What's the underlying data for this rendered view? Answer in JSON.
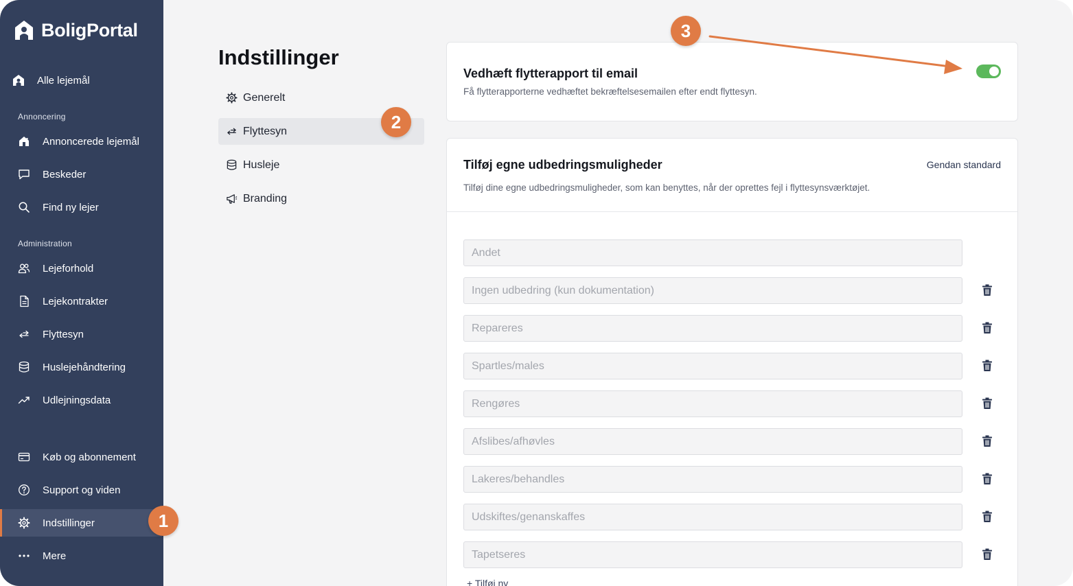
{
  "sidebar": {
    "brand": "BoligPortal",
    "top_item": {
      "label": "Alle lejemål",
      "icon": "house-icon"
    },
    "sections": [
      {
        "label": "Annoncering",
        "items": [
          {
            "label": "Annoncerede lejemål",
            "icon": "house-listing-icon"
          },
          {
            "label": "Beskeder",
            "icon": "chat-bubble-icon"
          },
          {
            "label": "Find ny lejer",
            "icon": "search-icon"
          }
        ]
      },
      {
        "label": "Administration",
        "items": [
          {
            "label": "Lejeforhold",
            "icon": "users-icon"
          },
          {
            "label": "Lejekontrakter",
            "icon": "document-icon"
          },
          {
            "label": "Flyttesyn",
            "icon": "swap-arrows-icon"
          },
          {
            "label": "Huslejehåndtering",
            "icon": "database-icon"
          },
          {
            "label": "Udlejningsdata",
            "icon": "trend-icon"
          }
        ]
      }
    ],
    "bottom_items": [
      {
        "label": "Køb og abonnement",
        "icon": "credit-card-icon"
      },
      {
        "label": "Support og viden",
        "icon": "help-circle-icon"
      },
      {
        "label": "Indstillinger",
        "icon": "gear-icon",
        "active": true
      },
      {
        "label": "Mere",
        "icon": "more-dots-icon"
      }
    ]
  },
  "settings": {
    "title": "Indstillinger",
    "nav": [
      {
        "label": "Generelt",
        "icon": "gear-icon"
      },
      {
        "label": "Flyttesyn",
        "icon": "swap-arrows-icon",
        "active": true
      },
      {
        "label": "Husleje",
        "icon": "database-icon"
      },
      {
        "label": "Branding",
        "icon": "megaphone-icon"
      }
    ]
  },
  "email_card": {
    "title": "Vedhæft flytterapport til email",
    "description": "Få flytterapporterne vedhæftet bekræftelsesemailen efter endt flyttesyn.",
    "toggle_on": true,
    "toggle_color": "#5cb85c"
  },
  "options_card": {
    "title": "Tilføj egne udbedringsmuligheder",
    "reset_label": "Gendan standard",
    "description": "Tilføj dine egne udbedringsmuligheder, som kan benyttes, når der oprettes fejl i flyttesynsværktøjet.",
    "options": [
      {
        "placeholder": "Andet",
        "deletable": false
      },
      {
        "placeholder": "Ingen udbedring (kun dokumentation)",
        "deletable": true
      },
      {
        "placeholder": "Repareres",
        "deletable": true
      },
      {
        "placeholder": "Spartles/males",
        "deletable": true
      },
      {
        "placeholder": "Rengøres",
        "deletable": true
      },
      {
        "placeholder": "Afslibes/afhøvles",
        "deletable": true
      },
      {
        "placeholder": "Lakeres/behandles",
        "deletable": true
      },
      {
        "placeholder": "Udskiftes/genanskaffes",
        "deletable": true
      },
      {
        "placeholder": "Tapetseres",
        "deletable": true
      }
    ],
    "add_more_label": "+ Tilføj ny"
  },
  "annotations": {
    "badges": [
      "1",
      "2",
      "3"
    ],
    "color": "#e07b45"
  },
  "colors": {
    "sidebar_bg": "#33405c",
    "accent": "#e07b45",
    "toggle_on": "#5cb85c"
  }
}
